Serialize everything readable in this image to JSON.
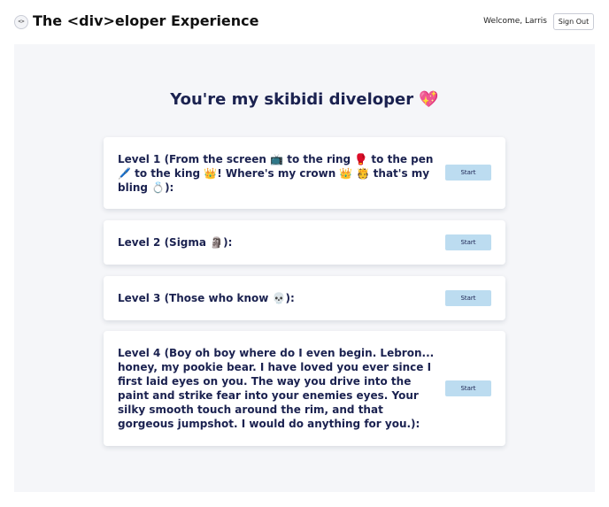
{
  "header": {
    "logo_glyph": "<>",
    "title": "The <div>eloper Experience",
    "welcome": "Welcome, Larris",
    "sign_out_label": "Sign Out"
  },
  "main": {
    "heading": "You're my skibidi diveloper 💖",
    "levels": [
      {
        "label": "Level 1 (From the screen 📺 to the ring 🥊 to the pen 🖊️ to the king 👑! Where's my crown 👑 🫅 that's my bling 💍):",
        "button_label": "Start"
      },
      {
        "label": "Level 2 (Sigma 🗿):",
        "button_label": "Start"
      },
      {
        "label": "Level 3 (Those who know 💀):",
        "button_label": "Start"
      },
      {
        "label": "Level 4 (Boy oh boy where do I even begin. Lebron... honey, my pookie bear. I have loved you ever since I first laid eyes on you. The way you drive into the paint and strike fear into your enemies eyes. Your silky smooth touch around the rim, and that gorgeous jumpshot. I would do anything for you.):",
        "button_label": "Start"
      }
    ]
  },
  "colors": {
    "accent_button": "#bcdcf0",
    "text_primary": "#1b2250",
    "background_panel": "#f5f6f9"
  }
}
